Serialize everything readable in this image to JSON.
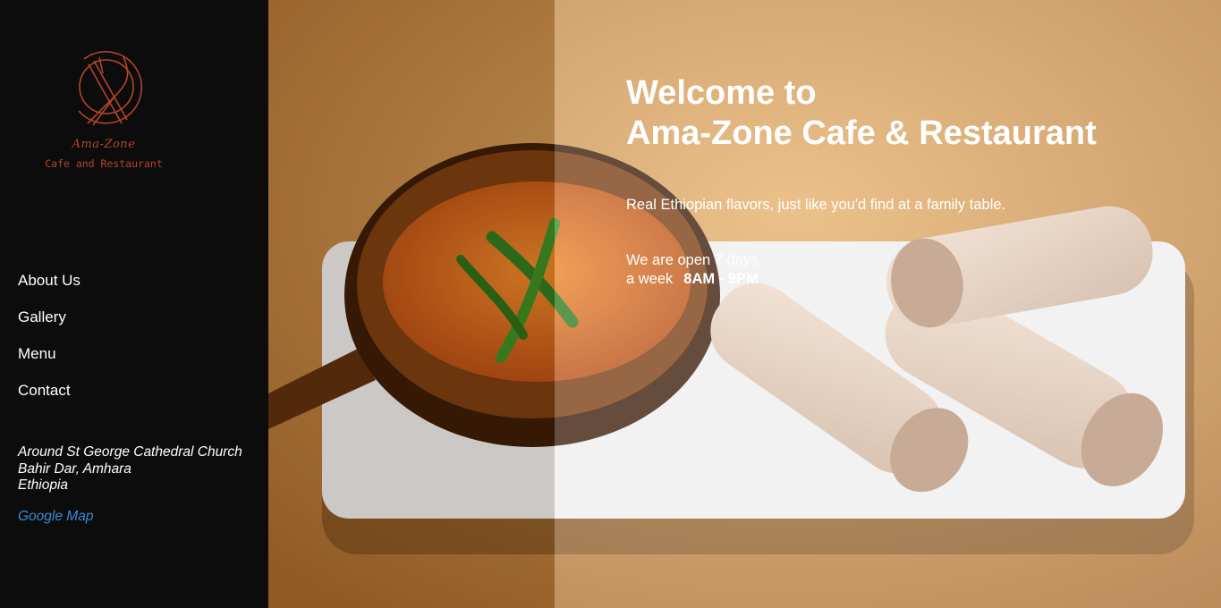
{
  "brand": {
    "script_name": "Ama-Zone",
    "subtitle": "Cafe and Restaurant",
    "color": "#b5452b"
  },
  "nav": {
    "items": [
      {
        "label": "About Us"
      },
      {
        "label": "Gallery"
      },
      {
        "label": "Menu"
      },
      {
        "label": "Contact"
      }
    ]
  },
  "address": {
    "line1": "Around St George Cathedral Church",
    "line2": "Bahir Dar, Amhara",
    "line3": "Ethiopia",
    "map_link": "Google Map",
    "link_color": "#3a8bd6"
  },
  "hero": {
    "title_line1": "Welcome to",
    "title_line2": "Ama-Zone Cafe & Restaurant",
    "tagline": "Real Ethiopian flavors, just like you'd find at a family table.",
    "hours_line1": "We are open 7 days",
    "hours_line2_prefix": "a week",
    "hours_time": "8AM - 9PM",
    "image_icon": "food-photo"
  }
}
